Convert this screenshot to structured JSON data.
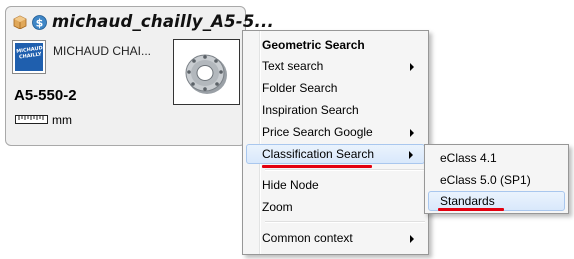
{
  "node": {
    "title": "michaud_chailly_A5-5...",
    "manufacturer": "MICHAUD CHAI...",
    "logo_text": "MICHAUD CHAILLY",
    "part_number": "A5-550-2",
    "unit": "mm",
    "icons": [
      "package-icon",
      "dollar-icon",
      "ruler-icon"
    ]
  },
  "context_menu": {
    "items": [
      {
        "label": "Geometric Search",
        "bold": true
      },
      {
        "label": "Text search",
        "submenu": true
      },
      {
        "label": "Folder Search"
      },
      {
        "label": "Inspiration Search"
      },
      {
        "label": "Price Search Google",
        "submenu": true
      },
      {
        "label": "Classification Search",
        "submenu": true,
        "highlighted": true
      },
      {
        "label": "Hide Node"
      },
      {
        "label": "Zoom"
      },
      {
        "label": "Common context",
        "submenu": true
      }
    ]
  },
  "submenu": {
    "items": [
      {
        "label": "eClass 4.1"
      },
      {
        "label": "eClass 5.0 (SP1)"
      },
      {
        "label": "Standards",
        "highlighted": true
      }
    ]
  },
  "colors": {
    "highlight_underline": "#e3000f",
    "menu_background": "#f5f5f5",
    "node_background": "#f0f0f0",
    "logo_blue": "#1f5fae"
  }
}
